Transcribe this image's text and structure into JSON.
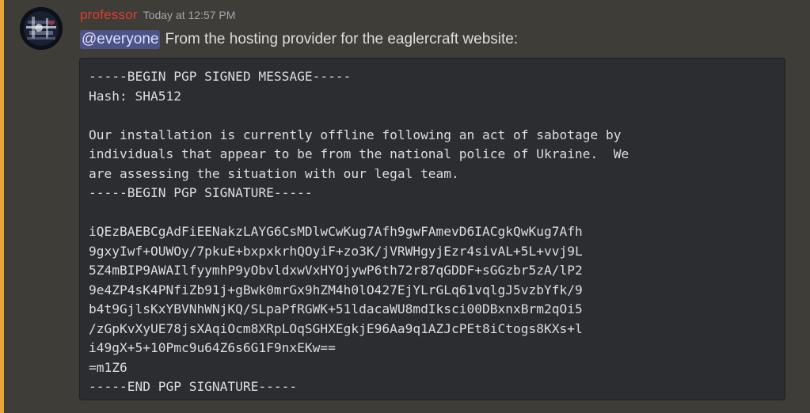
{
  "message": {
    "username": "professor",
    "timestamp": "Today at 12:57 PM",
    "mention": "@everyone",
    "text": "From the hosting provider for the eaglercraft website:",
    "code_lines": [
      "-----BEGIN PGP SIGNED MESSAGE-----",
      "Hash: SHA512",
      "",
      "Our installation is currently offline following an act of sabotage by",
      "individuals that appear to be from the national police of Ukraine.  We",
      "are assessing the situation with our legal team.",
      "-----BEGIN PGP SIGNATURE-----",
      "",
      "iQEzBAEBCgAdFiEENakzLAYG6CsMDlwCwKug7Afh9gwFAmevD6IACgkQwKug7Afh",
      "9gxyIwf+OUWOy/7pkuE+bxpxkrhQOyiF+zo3K/jVRWHgyjEzr4sivAL+5L+vvj9L",
      "5Z4mBIP9AWAIlfyymhP9yObvldxwVxHYOjywP6th72r87qGDDF+sGGzbr5zA/lP2",
      "9e4ZP4sK4PNfiZb91j+gBwk0mrGx9hZM4h0lO427EjYLrGLq61vqlgJ5vzbYfk/9",
      "b4t9GjlsKxYBVNhWNjKQ/SLpaPfRGWK+51ldacaWU8mdIksci00DBxnxBrm2qOi5",
      "/zGpKvXyUE78jsXAqiOcm8XRpLOqSGHXEgkjE96Aa9q1AZJcPEt8iCtogs8KXs+l",
      "i49gX+5+10Pmc9u64Z6s6G1F9nxEKw==",
      "=m1Z6",
      "-----END PGP SIGNATURE-----"
    ]
  },
  "colors": {
    "mention_bar": "#e8a63a",
    "username": "#e03c2e",
    "mention_bg": "#4d5287",
    "codeblock_bg": "#2b2d31"
  },
  "icons": {
    "avatar": "user-avatar-image"
  }
}
